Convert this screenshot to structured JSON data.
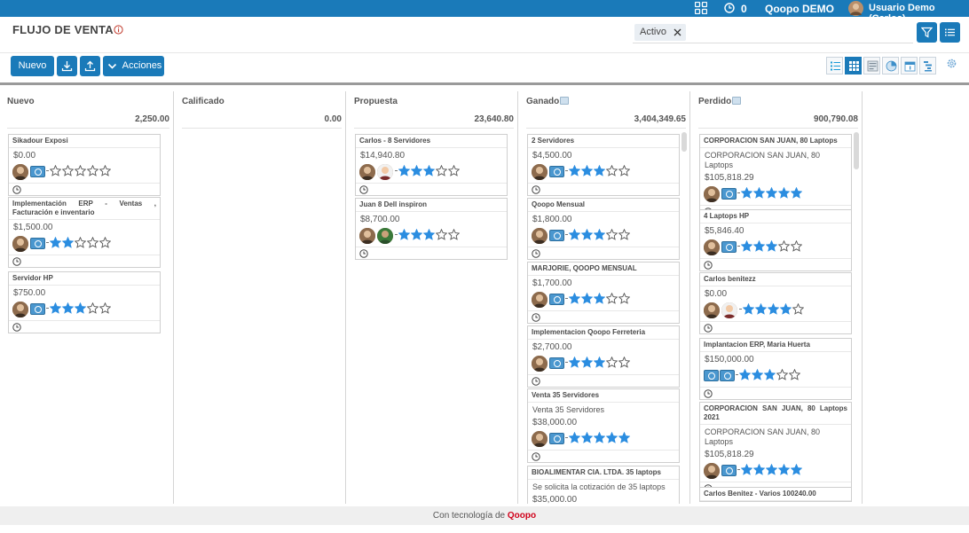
{
  "topbar": {
    "notification_count": "0",
    "company": "Qoopo DEMO",
    "user": "Usuario Demo (Carlos)",
    "bar_color": "#1a7ab9",
    "icons": [
      "apps-grid-icon",
      "clock-icon",
      "avatar-icon"
    ]
  },
  "header": {
    "title": "FLUJO DE VENTA",
    "filter_facet": "Activo"
  },
  "toolbar": {
    "new_label": "Nuevo",
    "actions_label": "Acciones",
    "views": [
      "list-view",
      "kanban-view",
      "form-view",
      "graph-view",
      "calendar-view",
      "gantt-view"
    ],
    "active_view": "kanban-view"
  },
  "columns": [
    {
      "title": "Nuevo",
      "total": "2,250.00",
      "has_tag": false,
      "cards": [
        {
          "title": "Sikadour Exposi",
          "amount": "$0.00",
          "stars": 0,
          "people": [
            "avatar",
            "badge"
          ]
        },
        {
          "title": "Implementación ERP - Ventas , Facturación e inventario",
          "amount": "$1,500.00",
          "stars": 2,
          "people": [
            "avatar",
            "badge"
          ]
        },
        {
          "title": "Servidor HP",
          "amount": "$750.00",
          "stars": 3,
          "people": [
            "avatar",
            "badge"
          ]
        }
      ]
    },
    {
      "title": "Calificado",
      "total": "0.00",
      "has_tag": false,
      "cards": []
    },
    {
      "title": "Propuesta",
      "total": "23,640.80",
      "has_tag": false,
      "cards": [
        {
          "title": "Carlos - 8 Servidores",
          "amount": "$14,940.80",
          "stars": 3,
          "people": [
            "avatar",
            "avatar2"
          ]
        },
        {
          "title": "Juan 8 Dell inspiron",
          "amount": "$8,700.00",
          "stars": 3,
          "people": [
            "avatar",
            "avatar3"
          ]
        }
      ]
    },
    {
      "title": "Ganado",
      "total": "3,404,349.65",
      "has_tag": true,
      "cards": [
        {
          "title": "2 Servidores",
          "amount": "$4,500.00",
          "stars": 3,
          "people": [
            "avatar",
            "badge"
          ]
        },
        {
          "title": "Qoopo Mensual",
          "amount": "$1,800.00",
          "stars": 3,
          "people": [
            "avatar",
            "badge"
          ]
        },
        {
          "title": "MARJORIE, QOOPO MENSUAL",
          "amount": "$1,700.00",
          "stars": 3,
          "people": [
            "avatar",
            "badge"
          ]
        },
        {
          "title": "Implementacion Qoopo Ferreteria",
          "amount": "$2,700.00",
          "stars": 3,
          "people": [
            "avatar",
            "badge"
          ]
        },
        {
          "title": "Venta 35 Servidores",
          "desc": "Venta 35 Servidores",
          "amount": "$38,000.00",
          "stars": 5,
          "people": [
            "avatar",
            "badge"
          ]
        },
        {
          "title": "BIOALIMENTAR CIA. LTDA. 35 laptops",
          "desc": "Se solicita la cotización de 35 laptops",
          "amount": "$35,000.00",
          "stars": -1,
          "people": []
        }
      ]
    },
    {
      "title": "Perdido",
      "total": "900,790.08",
      "has_tag": true,
      "cards": [
        {
          "title": "CORPORACION SAN JUAN, 80 Laptops",
          "desc": "CORPORACION SAN JUAN, 80 Laptops",
          "amount": "$105,818.29",
          "stars": 5,
          "people": [
            "avatar",
            "badge"
          ]
        },
        {
          "title": "4 Laptops HP",
          "amount": "$5,846.40",
          "stars": 3,
          "people": [
            "avatar",
            "badge"
          ]
        },
        {
          "title": "Carlos benitezz",
          "amount": "$0.00",
          "stars": 4,
          "people": [
            "avatar",
            "avatar2"
          ]
        },
        {
          "title": "Implantacion ERP, Maria Huerta",
          "amount": "$150,000.00",
          "stars": 3,
          "people": [
            "badge",
            "badge"
          ]
        },
        {
          "title": "CORPORACION SAN JUAN, 80 Laptops 2021",
          "desc": "CORPORACION SAN JUAN, 80 Laptops",
          "amount": "$105,818.29",
          "stars": 5,
          "people": [
            "avatar",
            "badge"
          ]
        },
        {
          "title": "Carlos Benitez - Varios 100240.00",
          "stars": -1,
          "people": []
        }
      ]
    }
  ],
  "footer": {
    "text": "Con tecnología de",
    "brand": "Qoopo"
  }
}
